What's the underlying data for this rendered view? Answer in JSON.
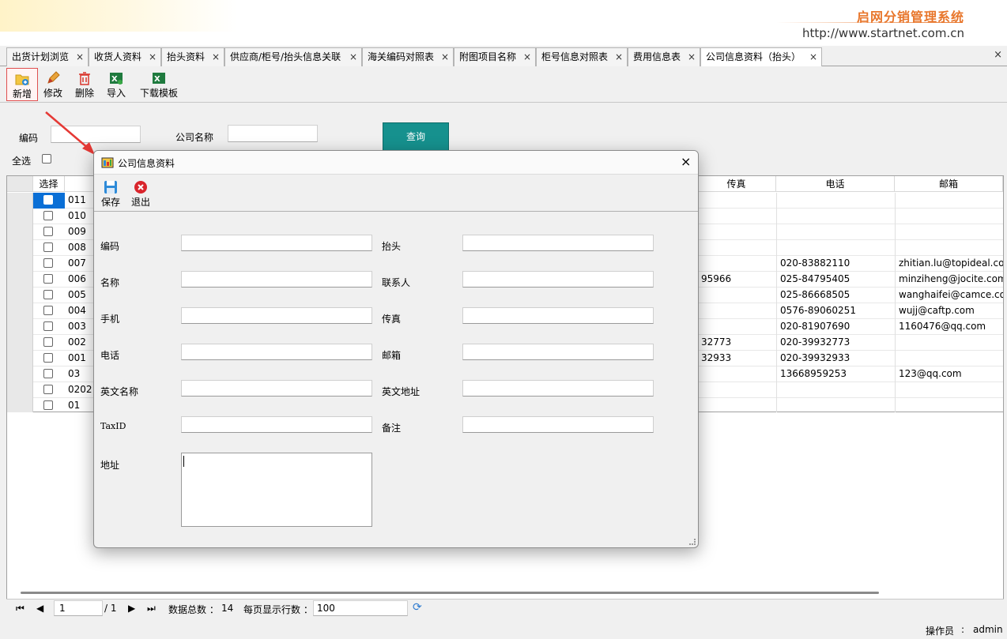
{
  "header": {
    "brand": "启网分销管理系统",
    "url": "http://www.startnet.com.cn"
  },
  "tabs": [
    {
      "label": "出货计划浏览"
    },
    {
      "label": "收货人资料"
    },
    {
      "label": "抬头资料"
    },
    {
      "label": "供应商/柜号/抬头信息关联"
    },
    {
      "label": "海关编码对照表"
    },
    {
      "label": "附图项目名称"
    },
    {
      "label": "柜号信息对照表"
    },
    {
      "label": "费用信息表"
    },
    {
      "label": "公司信息资料（抬头）"
    }
  ],
  "tab_close_glyph": "×",
  "toolbar": {
    "add": "新增",
    "edit": "修改",
    "delete": "删除",
    "import": "导入",
    "download_template": "下载模板"
  },
  "filter": {
    "code_label": "编码",
    "code_value": "",
    "name_label": "公司名称",
    "name_value": "",
    "query_button": "查询",
    "select_all": "全选"
  },
  "grid": {
    "columns": {
      "select": "选择",
      "fax": "传真",
      "phone": "电话",
      "email": "邮箱"
    },
    "rows": [
      {
        "code": "011",
        "fax": "",
        "phone": "",
        "email": ""
      },
      {
        "code": "010",
        "fax": "",
        "phone": "",
        "email": ""
      },
      {
        "code": "009",
        "fax": "",
        "phone": "",
        "email": ""
      },
      {
        "code": "008",
        "fax": "",
        "phone": "",
        "email": ""
      },
      {
        "code": "007",
        "fax": "",
        "phone": "020-83882110",
        "email": "zhitian.lu@topideal.com"
      },
      {
        "code": "006",
        "fax": "95966",
        "phone": "025-84795405",
        "email": "minziheng@jocite.com"
      },
      {
        "code": "005",
        "fax": "",
        "phone": "025-86668505",
        "email": "wanghaifei@camce.com."
      },
      {
        "code": "004",
        "fax": "",
        "phone": "0576-89060251",
        "email": "wujj@caftp.com"
      },
      {
        "code": "003",
        "fax": "",
        "phone": "020-81907690",
        "email": "1160476@qq.com"
      },
      {
        "code": "002",
        "fax": "32773",
        "phone": "020-39932773",
        "email": ""
      },
      {
        "code": "001",
        "fax": "32933",
        "phone": "020-39932933",
        "email": ""
      },
      {
        "code": "03",
        "fax": "",
        "phone": "13668959253",
        "email": "123@qq.com"
      },
      {
        "code": "0202",
        "fax": "",
        "phone": "",
        "email": ""
      },
      {
        "code": "01",
        "fax": "",
        "phone": "",
        "email": ""
      }
    ]
  },
  "pager": {
    "page": "1",
    "of": "/ 1",
    "total_label": "数据总数 ：",
    "total": "14",
    "per_page_label": "每页显示行数 ：",
    "per_page": "100"
  },
  "status": {
    "operator_label": "操作员",
    "sep": ":",
    "user": "admin"
  },
  "dialog": {
    "title": "公司信息资料",
    "save": "保存",
    "exit": "退出",
    "fields": {
      "code": "编码",
      "header": "抬头",
      "name": "名称",
      "contact": "联系人",
      "mobile": "手机",
      "fax": "传真",
      "phone": "电话",
      "email": "邮箱",
      "en_name": "英文名称",
      "en_address": "英文地址",
      "tax_id": "TaxID",
      "remark": "备注",
      "address": "地址"
    }
  }
}
